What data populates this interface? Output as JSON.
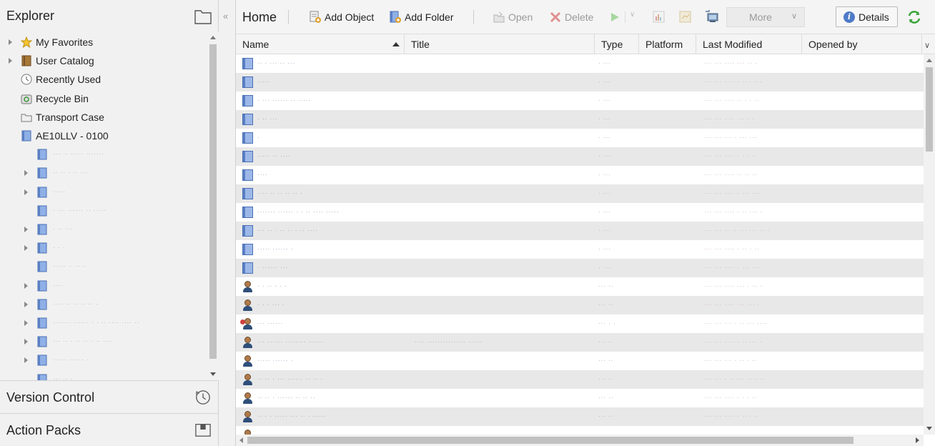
{
  "explorer": {
    "title": "Explorer",
    "fixed_items": [
      {
        "label": "My Favorites",
        "icon": "star-icon",
        "expandable": true
      },
      {
        "label": "User Catalog",
        "icon": "catalog-icon",
        "expandable": true
      },
      {
        "label": "Recently Used",
        "icon": "clock-icon",
        "expandable": false
      },
      {
        "label": "Recycle Bin",
        "icon": "recycle-bin-icon",
        "expandable": false
      },
      {
        "label": "Transport Case",
        "icon": "transport-case-icon",
        "expandable": false
      },
      {
        "label": "AE10LLV - 0100",
        "icon": "system-icon",
        "expandable": false
      }
    ],
    "child_items": [
      {
        "label": "··· ·· ····· ·······",
        "expandable": false
      },
      {
        "label": "·· ·· · ·· ···",
        "expandable": true
      },
      {
        "label": "·····",
        "expandable": true
      },
      {
        "label": "· ··· ······ ·· ·····",
        "expandable": false
      },
      {
        "label": "· ·· ···",
        "expandable": true
      },
      {
        "label": "· · ·",
        "expandable": true
      },
      {
        "label": "····· ·· ····",
        "expandable": false
      },
      {
        "label": "····",
        "expandable": true
      },
      {
        "label": "···· ·· ·· ·· ·· ·",
        "expandable": true
      },
      {
        "label": "······· ······ · · ·· ···· ···· ··",
        "expandable": true
      },
      {
        "label": "··· ·· · ·· ·· · ·· ····",
        "expandable": true
      },
      {
        "label": "····· ······ ·",
        "expandable": true
      },
      {
        "label": "··· ·· ·",
        "expandable": false
      }
    ],
    "sections": [
      {
        "label": "Version Control",
        "icon": "history-icon"
      },
      {
        "label": "Action Packs",
        "icon": "package-icon"
      }
    ]
  },
  "toolbar": {
    "home": "Home",
    "add_object": "Add Object",
    "add_folder": "Add Folder",
    "open": "Open",
    "delete": "Delete",
    "more": "More",
    "details": "Details"
  },
  "table": {
    "columns": [
      "Name",
      "Title",
      "Type",
      "Platform",
      "Last Modified",
      "Opened by"
    ],
    "sorted_by": "Name",
    "rows": [
      {
        "kind": "folder",
        "name": "·· · ··· ·· ···",
        "title": "",
        "type": "· ···",
        "modified": "··· ··· ···· ··· ·· ·"
      },
      {
        "kind": "folder",
        "name": "·····",
        "title": "",
        "type": "· ···",
        "modified": "··· ··· ···· · ·· · ···"
      },
      {
        "kind": "folder",
        "name": "· ··· ······ ·· ·····",
        "title": "",
        "type": "· ···",
        "modified": "··· ··· ···· ·· · · ··"
      },
      {
        "kind": "folder",
        "name": "· ·· ···",
        "title": "",
        "type": "· ···",
        "modified": "··· ··· ···· ··· · ·"
      },
      {
        "kind": "folder",
        "name": "·",
        "title": "",
        "type": "· ···",
        "modified": "··· ··· ··· · ··· ···"
      },
      {
        "kind": "folder",
        "name": "····· ·· ····",
        "title": "",
        "type": "· ···",
        "modified": "··· ··· ···· · · · ··"
      },
      {
        "kind": "folder",
        "name": "····",
        "title": "",
        "type": "· ···",
        "modified": "··· ··· ···· ·· ·· ··"
      },
      {
        "kind": "folder",
        "name": "···· ·· ·· ·· ·· ·",
        "title": "",
        "type": "· ···",
        "modified": "··· ··· ···· · ··· ···"
      },
      {
        "kind": "folder",
        "name": "······· ······ · · ·· ···· ·····",
        "title": "",
        "type": "· ···",
        "modified": "··· ··· ···· · ·· ··· ·"
      },
      {
        "kind": "folder",
        "name": "··· ·· · ·· ·· · ·· ····",
        "title": "",
        "type": "· ···",
        "modified": "··· ··· ·· ·· ··· ··· ····"
      },
      {
        "kind": "folder",
        "name": "····· ······ ·",
        "title": "",
        "type": "· ···",
        "modified": "··· ··· ···· · ·· · ··"
      },
      {
        "kind": "folder",
        "name": "· ······ ···",
        "title": "",
        "type": "· ···",
        "modified": "··· ··· ···· · ··· ···"
      },
      {
        "kind": "user",
        "name": "· · ·· · · ·",
        "title": "",
        "type": "··· ··",
        "modified": "··· ··· ···· ··· · ·· ·"
      },
      {
        "kind": "user",
        "name": "· · · ··· ·",
        "title": "",
        "type": "··· ··",
        "modified": "··· ··· ···· ··· ··· ·"
      },
      {
        "kind": "usergroup",
        "name": "··· ······",
        "title": "",
        "type": "··· · ·",
        "modified": "··· ··· ··· · ·· ··· ····"
      },
      {
        "kind": "user",
        "name": "··· ······ ········ ······",
        "title": "···· ··············· ·····",
        "type": "··· ··",
        "modified": "··· ··· ···· · ·· ··· ·"
      },
      {
        "kind": "user",
        "name": "····· ······ ·",
        "title": "",
        "type": "··· ··",
        "modified": "··· ··· ··· · ·· · ··"
      },
      {
        "kind": "user",
        "name": "·· ·· · ··· ······ ·· ·· ·",
        "title": "",
        "type": "··· ··",
        "modified": "··· ··· · ·· ··· ·· ····"
      },
      {
        "kind": "user",
        "name": "·· ·· · ······ ·· ·· ··",
        "title": "",
        "type": "··· ··",
        "modified": "··· ··· ···· · · · ··"
      },
      {
        "kind": "user",
        "name": "·· · · ····· ··· ·· · ·····",
        "title": "",
        "type": "··· ··",
        "modified": "··· ··· ···· · ·· · ··"
      },
      {
        "kind": "user",
        "name": "·········· ·· · ···· ·",
        "title": "",
        "type": "··· ··",
        "modified": "··· ··· ·· ·· · ·"
      }
    ]
  },
  "colors": {
    "accent_blue": "#4e7ac7",
    "disabled_gray": "#9a9a9a",
    "green_refresh": "#3aa53a"
  }
}
